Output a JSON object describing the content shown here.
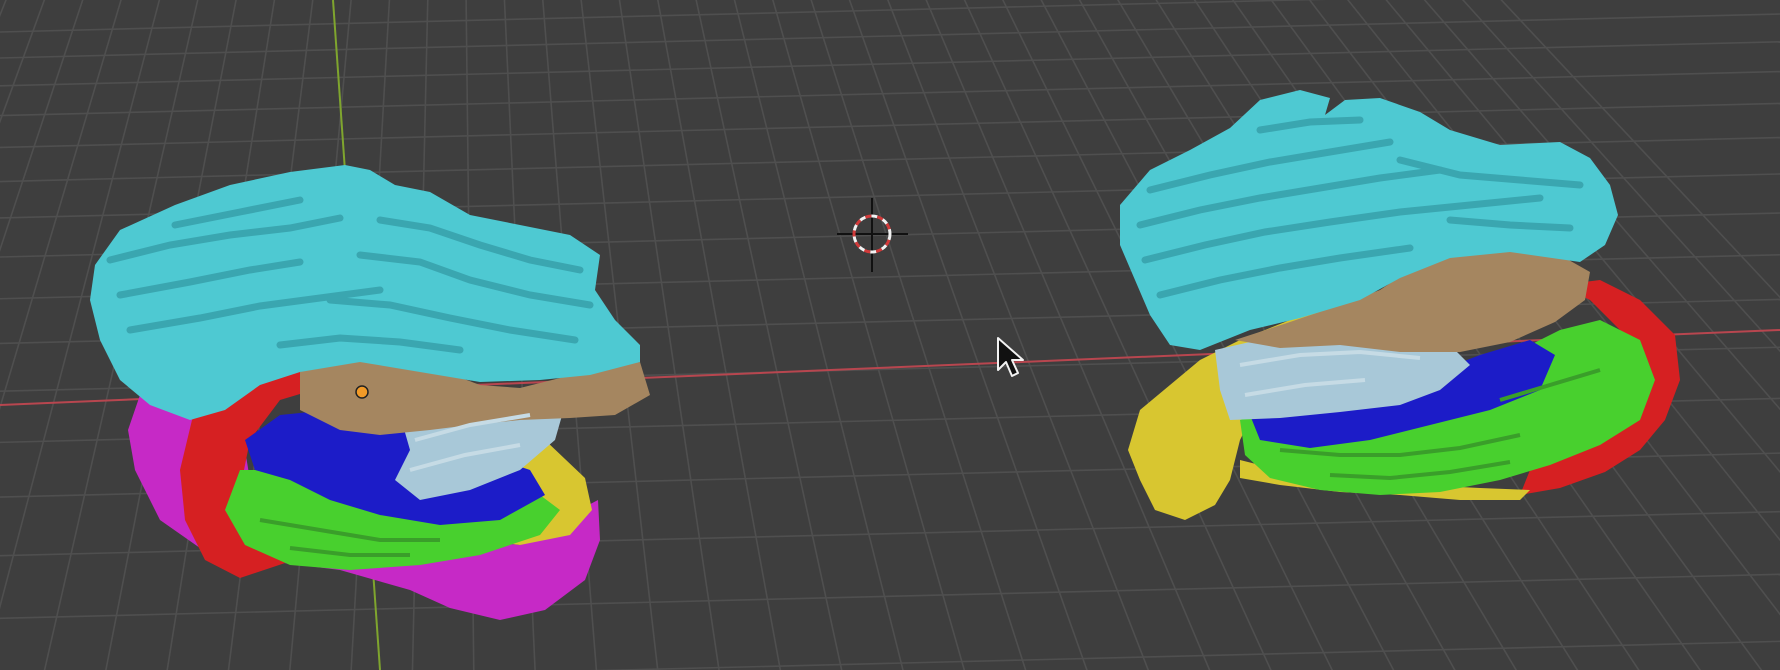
{
  "viewport": {
    "background_color": "#3e3e3e",
    "grid_color": "#4f4f4f",
    "x_axis_color": "#b8464f",
    "y_axis_color": "#7fa52e"
  },
  "objects": [
    {
      "id": "brain-mesh-left",
      "segment_colors": {
        "top": "#4ec9d2",
        "top_stripes": "#3aa6b0",
        "tan": "#a58660",
        "light_blue": "#a8c8d8",
        "blue": "#1c1cc8",
        "green": "#48d02e",
        "yellow": "#d8c630",
        "red": "#d62022",
        "magenta": "#c629c6"
      }
    },
    {
      "id": "brain-mesh-right",
      "segment_colors": {
        "top": "#4ec9d2",
        "top_stripes": "#3aa6b0",
        "tan": "#a58660",
        "light_blue": "#a8c8d8",
        "blue": "#1c1cc8",
        "green": "#48d02e",
        "yellow": "#d8c630",
        "red": "#d62022"
      }
    }
  ],
  "icons": {
    "cursor": "3d-cursor-icon",
    "pointer": "mouse-pointer-icon",
    "origin": "object-origin-icon"
  },
  "accent": {
    "origin_color": "#f19a28",
    "cursor_ring_a": "#d23a3a",
    "cursor_ring_b": "#f2f2f2"
  }
}
